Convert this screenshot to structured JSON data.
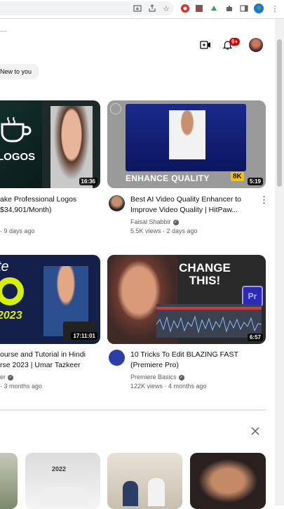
{
  "chip": {
    "label": "New to you"
  },
  "videos": [
    {
      "title_1": "ake Professional Logos",
      "title_2": "$34,901/Month)",
      "meta": "· 9 days ago",
      "duration": "16:36",
      "thumb_text": "LOGOS"
    },
    {
      "title_1": "Best AI Video Quality Enhancer to",
      "title_2": "Improve Video Quality | HitPaw...",
      "channel": "Faisal Shabbir",
      "views": "5.5K views · 2 days ago",
      "duration": "5:19",
      "thumb_text": "ENHANCE QUALITY",
      "badge": "8K"
    },
    {
      "title_1": "ourse and Tutorial in Hindi",
      "title_2": "rse 2023 | Umar Tazkeer",
      "channel": "er",
      "views": "· 3 months ago",
      "duration": "17:11:01",
      "thumb_text": "2023"
    },
    {
      "title_1": "10 Tricks To Edit BLAZING FAST",
      "title_2": "(Premiere Pro)",
      "channel": "Premiere Basics",
      "views": "122K views · 4 months ago",
      "duration": "6:57",
      "thumb_text_1": "CHANGE",
      "thumb_text_2": "THIS!",
      "app_badge": "Pr"
    }
  ],
  "notifications": {
    "count": "9+"
  },
  "shelf": {
    "thumb_text": "2022"
  },
  "colors": {
    "accent_red": "#cc0000",
    "premiere_purple": "#2b2bb8",
    "quality_yellow": "#f5c400"
  }
}
